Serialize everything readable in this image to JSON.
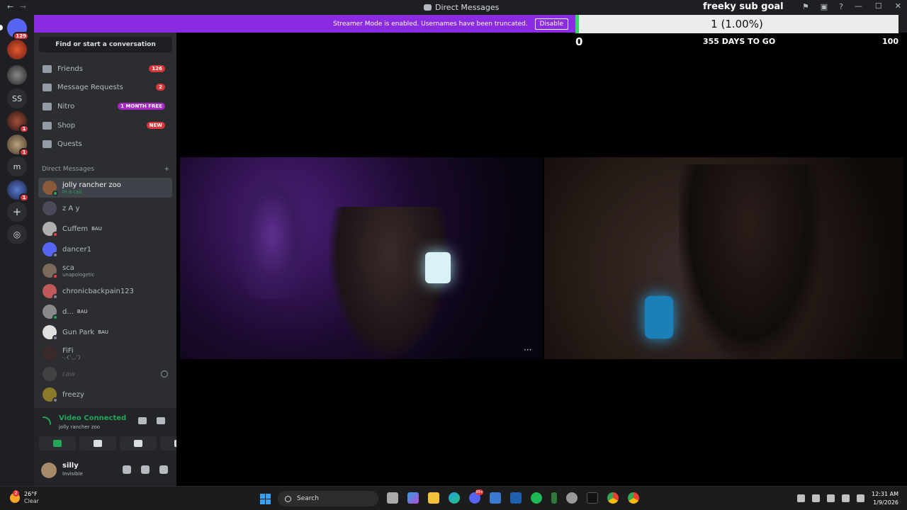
{
  "titlebar": {
    "back": "←",
    "forward": "→",
    "title": "Direct Messages",
    "minimize": "—",
    "maximize": "☐",
    "close": "✕"
  },
  "servers": [
    {
      "name": "discord-home",
      "badge": "129",
      "color": "#5865f2"
    },
    {
      "name": "server-avatar-1",
      "badge": "",
      "color": "#c0392b"
    },
    {
      "name": "server-avatar-2",
      "badge": "",
      "color": "#dcdcdc"
    },
    {
      "name": "server-text-ss",
      "label": "SS"
    },
    {
      "name": "server-avatar-3",
      "badge": "1",
      "color": "#6b3a2e"
    },
    {
      "name": "server-avatar-4",
      "badge": "1",
      "color": "#8a7a5a"
    },
    {
      "name": "server-text-m",
      "label": "m"
    },
    {
      "name": "server-avatar-5",
      "badge": "1",
      "color": "#2e4a8a"
    }
  ],
  "banner": {
    "text": "Streamer Mode is enabled. Usernames have been truncated.",
    "button": "Disable"
  },
  "sidebar": {
    "search_placeholder": "Find or start a conversation",
    "nav": [
      {
        "label": "Friends",
        "count": "126"
      },
      {
        "label": "Message Requests",
        "count": "2"
      },
      {
        "label": "Nitro",
        "pill": "1 MONTH FREE"
      },
      {
        "label": "Shop",
        "pill": "NEW"
      },
      {
        "label": "Quests"
      }
    ],
    "dm_header": "Direct Messages",
    "dm_add": "+",
    "dms": [
      {
        "name": "jolly rancher zoo",
        "sub": "In a call",
        "active": true,
        "color": "#8a5a3a",
        "status": "#23a55a"
      },
      {
        "name": "z A y",
        "sub": "",
        "color": "#4a4a5a",
        "status": ""
      },
      {
        "name": "Cuffem",
        "tag": "BAU",
        "color": "#b0b0b0",
        "status": "#f23f43"
      },
      {
        "name": "dancer1",
        "color": "#5865f2",
        "status": "#80848e"
      },
      {
        "name": "sca",
        "sub": "unapologetic",
        "color": "#7a6a5a",
        "status": "#f23f43"
      },
      {
        "name": "chronicbackpain123",
        "color": "#c05a5a",
        "status": "#80848e"
      },
      {
        "name": "d...",
        "tag": "BAU",
        "color": "#8a8a8a",
        "status": "#23a55a"
      },
      {
        "name": "Gun Park",
        "tag": "BAU",
        "color": "#e0e0e0",
        "status": "#80848e"
      },
      {
        "name": "FiFi",
        "sub": "·.·(˘◡˘)",
        "color": "#3a2a2a",
        "status": ""
      },
      {
        "name": "raw",
        "muted": true,
        "color": "#555555",
        "status": ""
      },
      {
        "name": "freezy",
        "color": "#8a7a2a",
        "status": "#80848e"
      }
    ]
  },
  "voice": {
    "status": "Video Connected",
    "channel": "jolly rancher zoo"
  },
  "user": {
    "name": "silly",
    "status": "Invisible"
  },
  "goal": {
    "title": "freeky sub goal",
    "progress_text": "1 (1.00%)",
    "progress": 0.01,
    "min": "0",
    "days": "355 DAYS TO GO",
    "max": "100"
  },
  "stream": {
    "more": "···"
  },
  "taskbar": {
    "temp": "26°F",
    "weather": "Clear",
    "weather_badge": "2",
    "search": "Search",
    "time": "12:31 AM",
    "date": "1/9/2026",
    "discord_badge": "99+"
  }
}
